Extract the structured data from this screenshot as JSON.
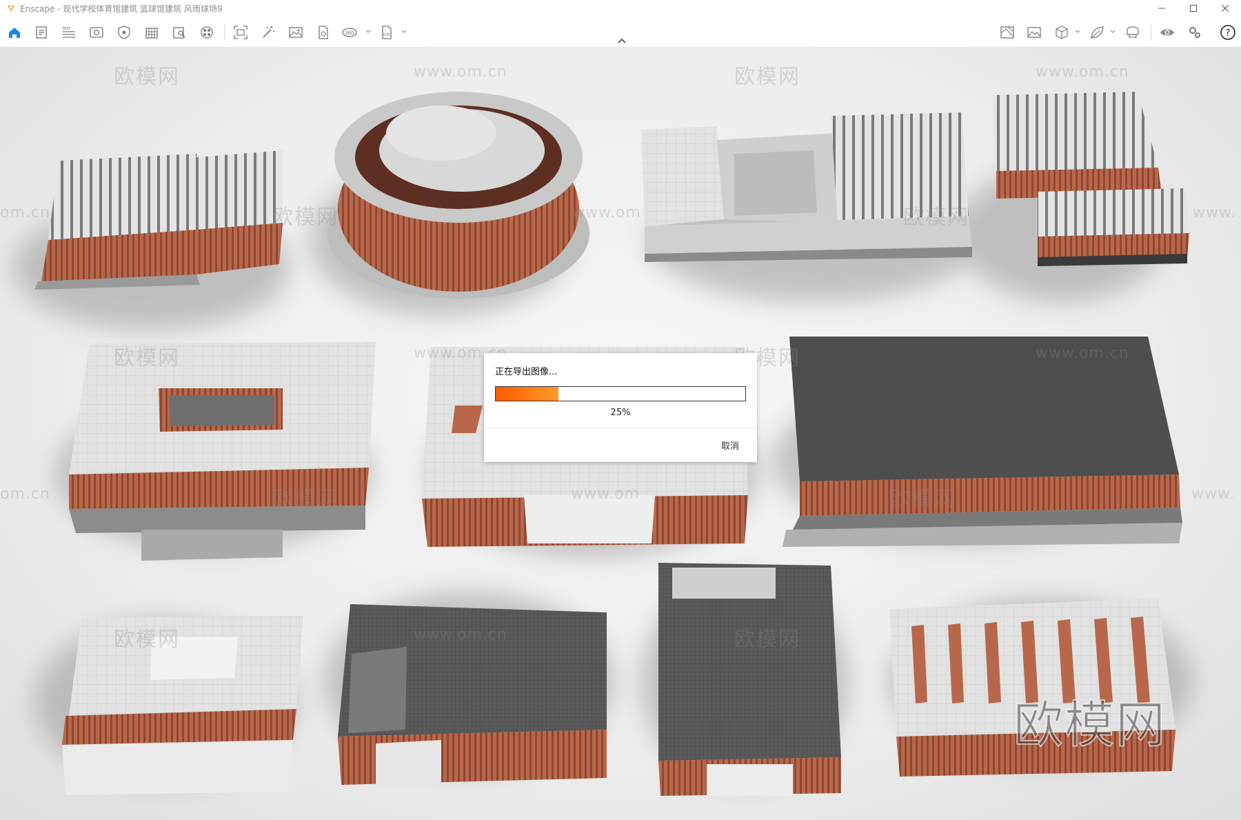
{
  "window": {
    "title": "Enscape - 现代学校体育馆建筑 篮球馆建筑 风雨球场9"
  },
  "toolbar": {
    "left_tools": [
      {
        "name": "home-icon",
        "label": "Home"
      },
      {
        "name": "document-icon",
        "label": "Document"
      },
      {
        "name": "bim-icon",
        "label": "BIM"
      },
      {
        "name": "view-icon",
        "label": "View"
      },
      {
        "name": "shield-icon",
        "label": "Shield"
      },
      {
        "name": "building-icon",
        "label": "Building"
      },
      {
        "name": "book-search-icon",
        "label": "Book search"
      },
      {
        "name": "assets-icon",
        "label": "Assets"
      },
      {
        "name": "screenshot-icon",
        "label": "Screenshot"
      },
      {
        "name": "magic-wand-icon",
        "label": "Magic wand"
      },
      {
        "name": "image-icon",
        "label": "Image"
      },
      {
        "name": "file-icon",
        "label": "File"
      },
      {
        "name": "panorama-360-icon",
        "label": "360"
      },
      {
        "name": "exe-export-icon",
        "label": "EXE"
      }
    ],
    "right_tools": [
      {
        "name": "map-icon",
        "label": "Map"
      },
      {
        "name": "gallery-icon",
        "label": "Gallery"
      },
      {
        "name": "cube-icon",
        "label": "Cube"
      },
      {
        "name": "leaf-icon",
        "label": "Leaf"
      },
      {
        "name": "vr-headset-icon",
        "label": "VR"
      },
      {
        "name": "eye-icon",
        "label": "Eye"
      },
      {
        "name": "settings-icon",
        "label": "Settings"
      },
      {
        "name": "help-icon",
        "label": "Help"
      }
    ],
    "accent_color": "#1e88e5"
  },
  "watermarks": {
    "brand": "欧模网",
    "url": "www.om.cn",
    "url_partial": "om.cn",
    "url_cut": "www.om",
    "url_cut2": "www."
  },
  "dialog": {
    "title": "正在导出图像...",
    "progress": 0.25,
    "progress_label": "25%",
    "cancel_label": "取消"
  }
}
